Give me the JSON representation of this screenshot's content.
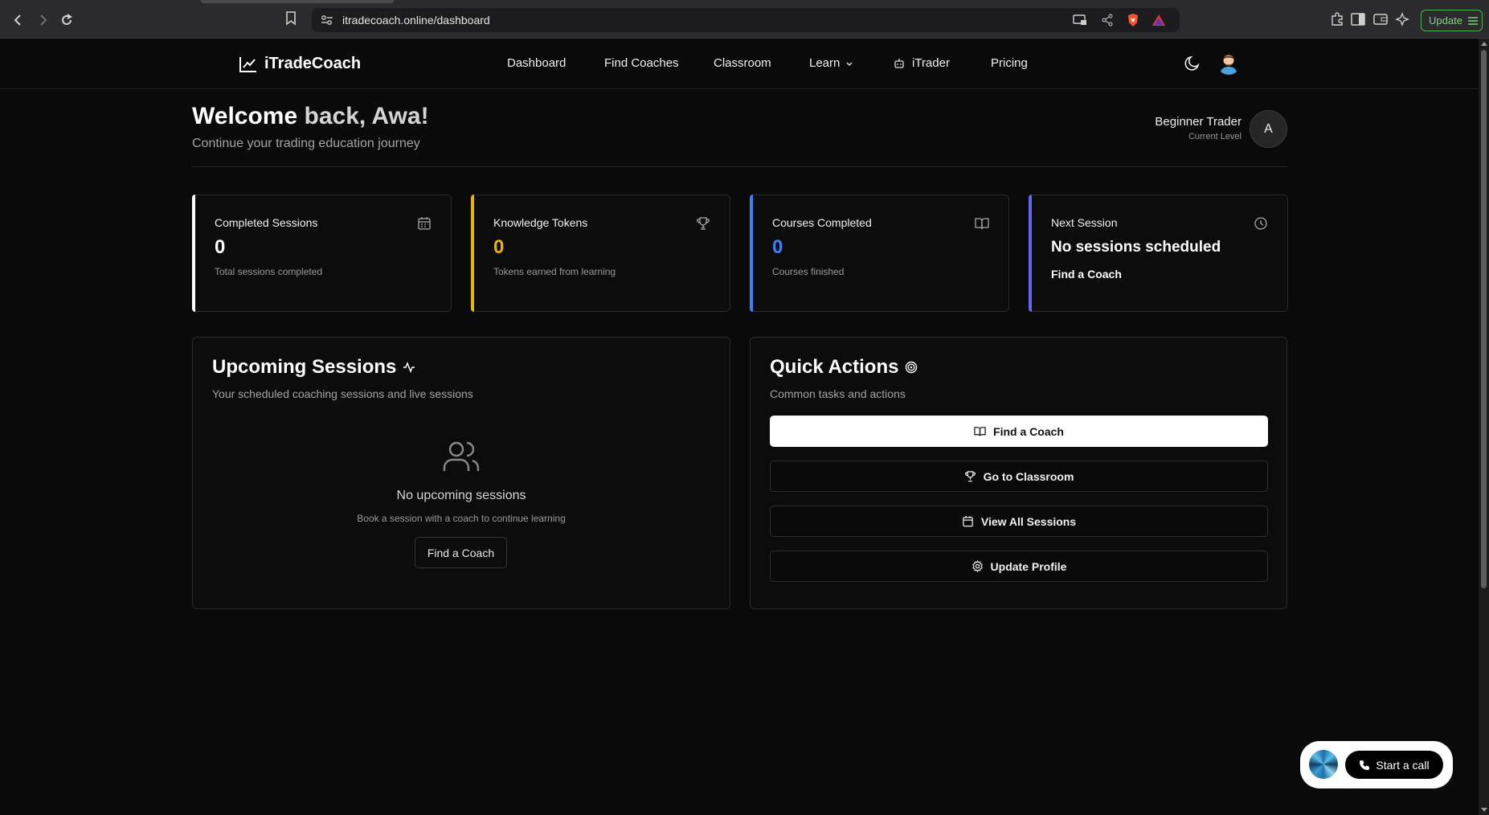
{
  "browser": {
    "url": "itradecoach.online/dashboard",
    "update_label": "Update"
  },
  "header": {
    "logo_text": "iTradeCoach",
    "nav": {
      "dashboard": "Dashboard",
      "find_coaches": "Find Coaches",
      "classroom": "Classroom",
      "learn": "Learn",
      "itrader": "iTrader",
      "pricing": "Pricing"
    }
  },
  "welcome": {
    "title_prefix": "Welcome ",
    "title_name": "back, Awa!",
    "subtitle": "Continue your trading education journey"
  },
  "level": {
    "name": "Beginner Trader",
    "caption": "Current Level",
    "avatar_initial": "A"
  },
  "stats": {
    "completed_sessions": {
      "label": "Completed Sessions",
      "value": "0",
      "caption": "Total sessions completed",
      "accent": "#ffffff"
    },
    "knowledge_tokens": {
      "label": "Knowledge Tokens",
      "value": "0",
      "caption": "Tokens earned from learning",
      "accent": "#eab308"
    },
    "courses_completed": {
      "label": "Courses Completed",
      "value": "0",
      "caption": "Courses finished",
      "accent": "#3b82f6"
    },
    "next_session": {
      "label": "Next Session",
      "value": "No sessions scheduled",
      "link": "Find a Coach",
      "accent": "#6366f1"
    }
  },
  "upcoming": {
    "title": "Upcoming Sessions",
    "subtitle": "Your scheduled coaching sessions and live sessions",
    "empty_title": "No upcoming sessions",
    "empty_subtitle": "Book a session with a coach to continue learning",
    "button": "Find a Coach"
  },
  "quick_actions": {
    "title": "Quick Actions",
    "subtitle": "Common tasks and actions",
    "find_coach": "Find a Coach",
    "classroom": "Go to Classroom",
    "sessions": "View All Sessions",
    "profile": "Update Profile"
  },
  "call_widget": {
    "label": "Start a call"
  }
}
